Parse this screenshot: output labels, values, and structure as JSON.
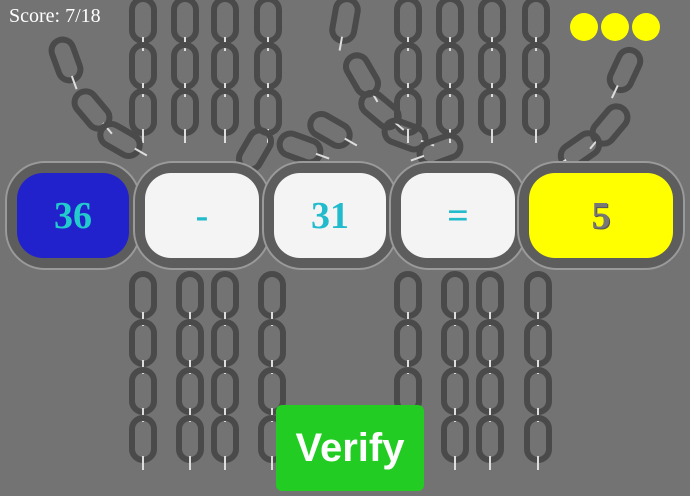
{
  "score": {
    "text": "Score: 7/18"
  },
  "lives": {
    "count": 3,
    "color": "#ffff00"
  },
  "equation": [
    {
      "text": "36",
      "bg": "#2222cc",
      "fg": "#22cccc",
      "role": "operand"
    },
    {
      "text": "-",
      "bg": "#f4f4f4",
      "fg": "#22bbcc",
      "role": "operator"
    },
    {
      "text": "31",
      "bg": "#f4f4f4",
      "fg": "#22bbcc",
      "role": "operand"
    },
    {
      "text": "=",
      "bg": "#f4f4f4",
      "fg": "#22bbcc",
      "role": "equals"
    },
    {
      "text": "5",
      "bg": "#ffff00",
      "fg": "#777777",
      "role": "answer"
    }
  ],
  "verify": {
    "label": "Verify",
    "color": "#22cc22"
  },
  "background": {
    "color": "#737373",
    "chain_color": "#4a4a4a"
  }
}
